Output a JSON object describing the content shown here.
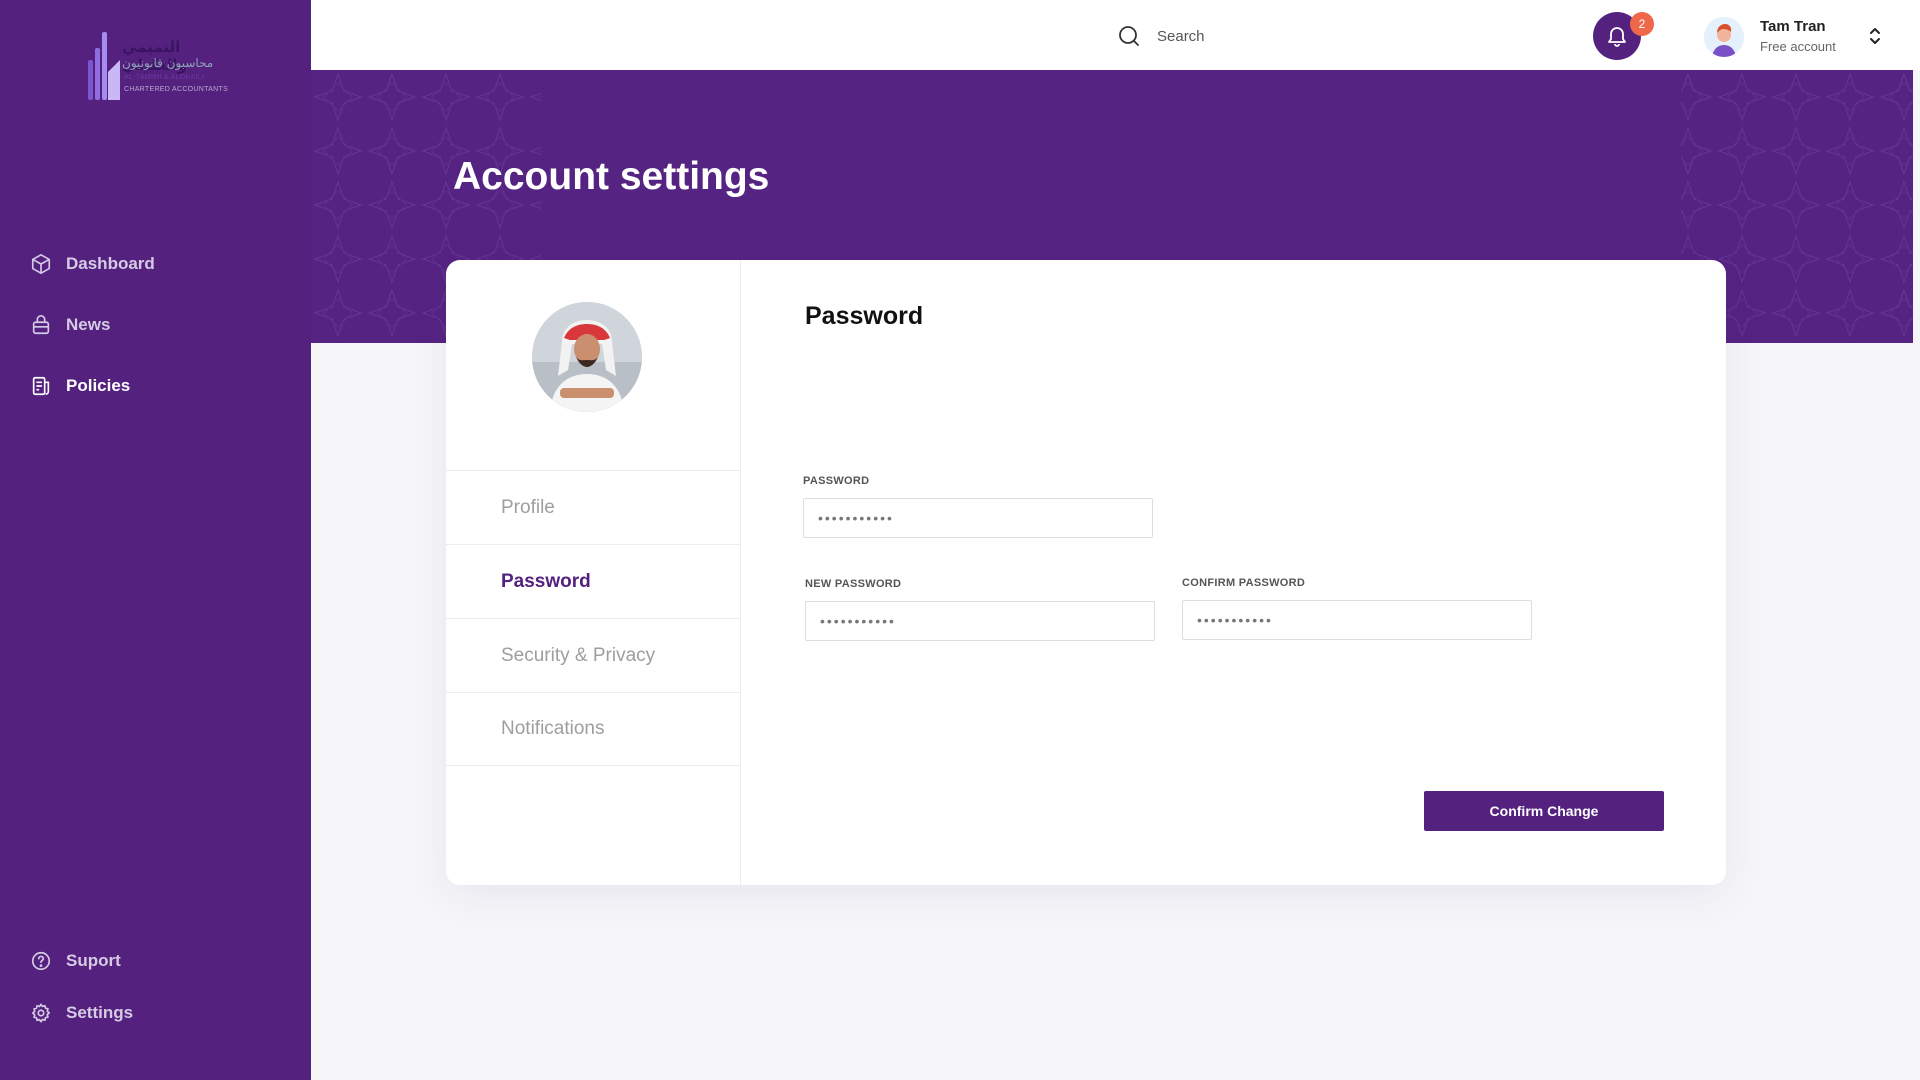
{
  "brand": {
    "logo_arabic_line1": "التميمي والعكيلي",
    "logo_arabic_line2": "محاسبون قانونيون",
    "logo_english_line1": "AL-TAMIMI & ALOKAILI",
    "logo_english_line2": "CHARTERED ACCOUNTANTS",
    "primary_color": "#54217f",
    "badge_color": "#f0684a"
  },
  "sidebar": {
    "items": [
      {
        "label": "Dashboard",
        "icon": "cube-icon",
        "active": false
      },
      {
        "label": "News",
        "icon": "bag-icon",
        "active": false
      },
      {
        "label": "Policies",
        "icon": "document-icon",
        "active": true
      }
    ],
    "bottom_items": [
      {
        "label": "Suport",
        "icon": "help-circle-icon"
      },
      {
        "label": "Settings",
        "icon": "gear-icon"
      }
    ]
  },
  "header": {
    "search_placeholder": "Search",
    "notification_count": "2",
    "user": {
      "name": "Tam Tran",
      "plan": "Free account"
    }
  },
  "page": {
    "title": "Account settings"
  },
  "settings": {
    "tabs": [
      {
        "label": "Profile",
        "active": false
      },
      {
        "label": "Password",
        "active": true
      },
      {
        "label": "Security & Privacy",
        "active": false
      },
      {
        "label": "Notifications",
        "active": false
      }
    ],
    "section_title": "Password",
    "fields": {
      "password": {
        "label": "PASSWORD",
        "value": "•••••••••••"
      },
      "new_password": {
        "label": "NEW PASSWORD",
        "value": "•••••••••••"
      },
      "confirm_password": {
        "label": "CONFIRM PASSWORD",
        "value": "•••••••••••"
      }
    },
    "confirm_label": "Confirm Change"
  }
}
